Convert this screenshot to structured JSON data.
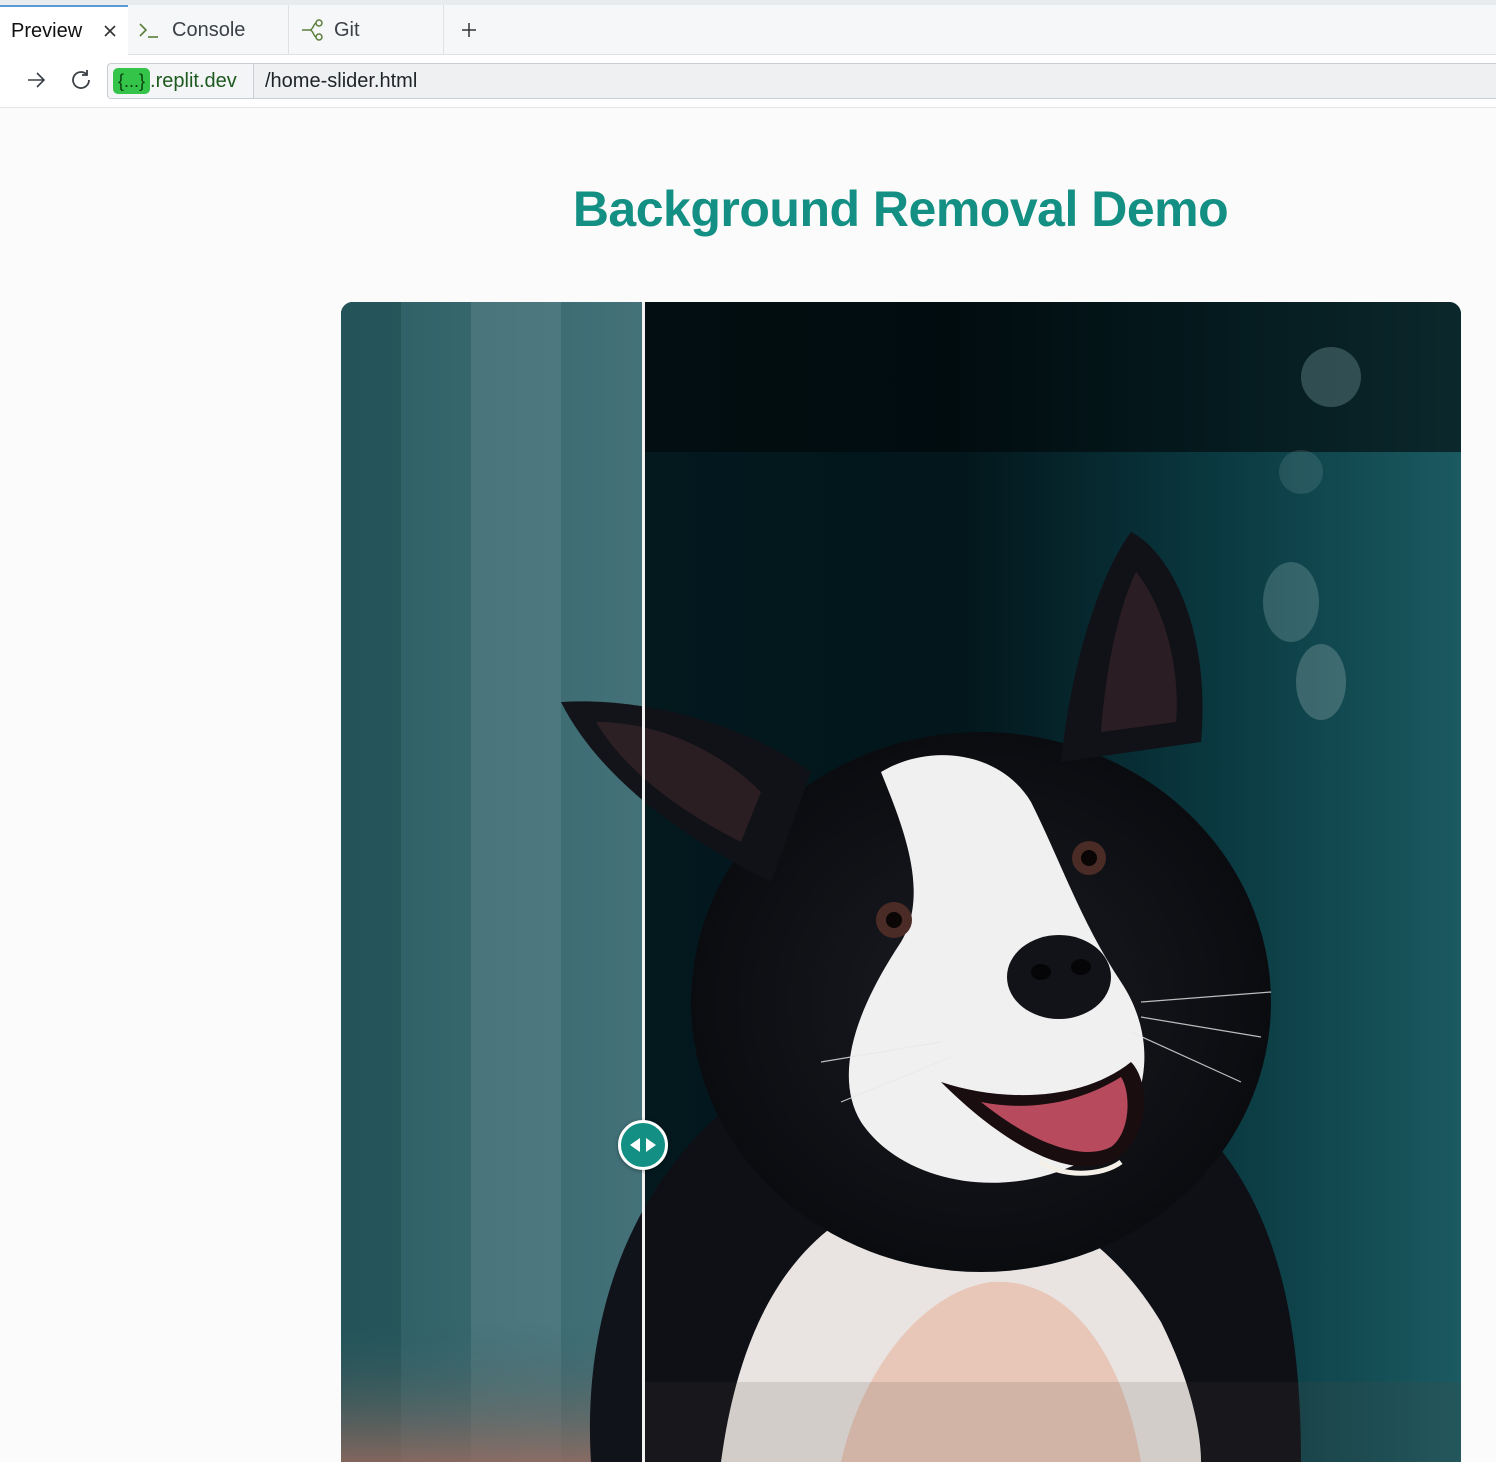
{
  "tabs": [
    {
      "label": "Preview",
      "active": true,
      "icon": "close-icon"
    },
    {
      "label": "Console",
      "icon": "terminal-icon"
    },
    {
      "label": "Git",
      "icon": "git-icon"
    }
  ],
  "new_tab_icon": "plus-icon",
  "address": {
    "badge": "{...}",
    "domain": ".replit.dev",
    "path": "/home-slider.html"
  },
  "page": {
    "title": "Background Removal Demo"
  },
  "slider": {
    "position_fraction": 0.27,
    "handle_icon": "left-right-arrows-icon",
    "accent": "#138f83"
  }
}
